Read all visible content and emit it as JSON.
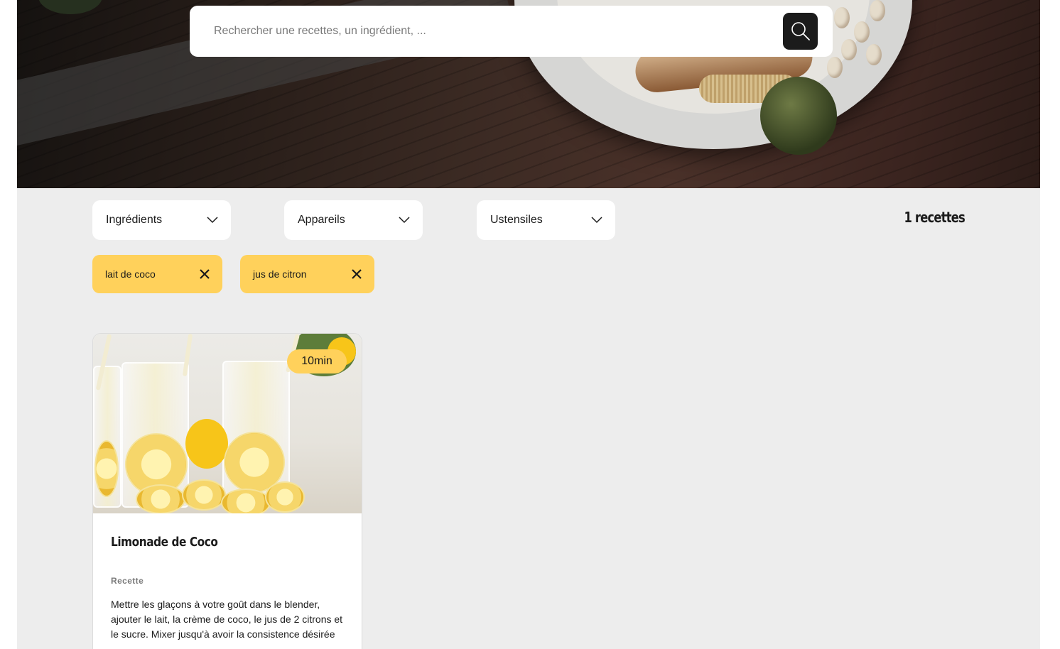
{
  "search": {
    "placeholder": "Rechercher une recettes, un ingrédient, ...",
    "button_icon": "search-icon"
  },
  "filters": [
    {
      "label": "Ingrédients",
      "icon": "chevron-down-icon"
    },
    {
      "label": "Appareils",
      "icon": "chevron-down-icon"
    },
    {
      "label": "Ustensiles",
      "icon": "chevron-down-icon"
    }
  ],
  "recipe_count": "1 recettes",
  "tags": [
    {
      "label": "lait de coco",
      "icon": "close-icon"
    },
    {
      "label": "jus de citron",
      "icon": "close-icon"
    }
  ],
  "recipes": [
    {
      "time": "10min",
      "title": "Limonade de Coco",
      "section_label": "Recette",
      "description": "Mettre les glaçons à votre goût dans le blender, ajouter le lait, la crème de coco, le jus de 2 citrons et le sucre. Mixer jusqu'à avoir la consistence désirée"
    }
  ],
  "colors": {
    "accent": "#FFD15B",
    "dark": "#1B1B1B",
    "background": "#EDEDED",
    "muted": "#7A7A7A"
  }
}
